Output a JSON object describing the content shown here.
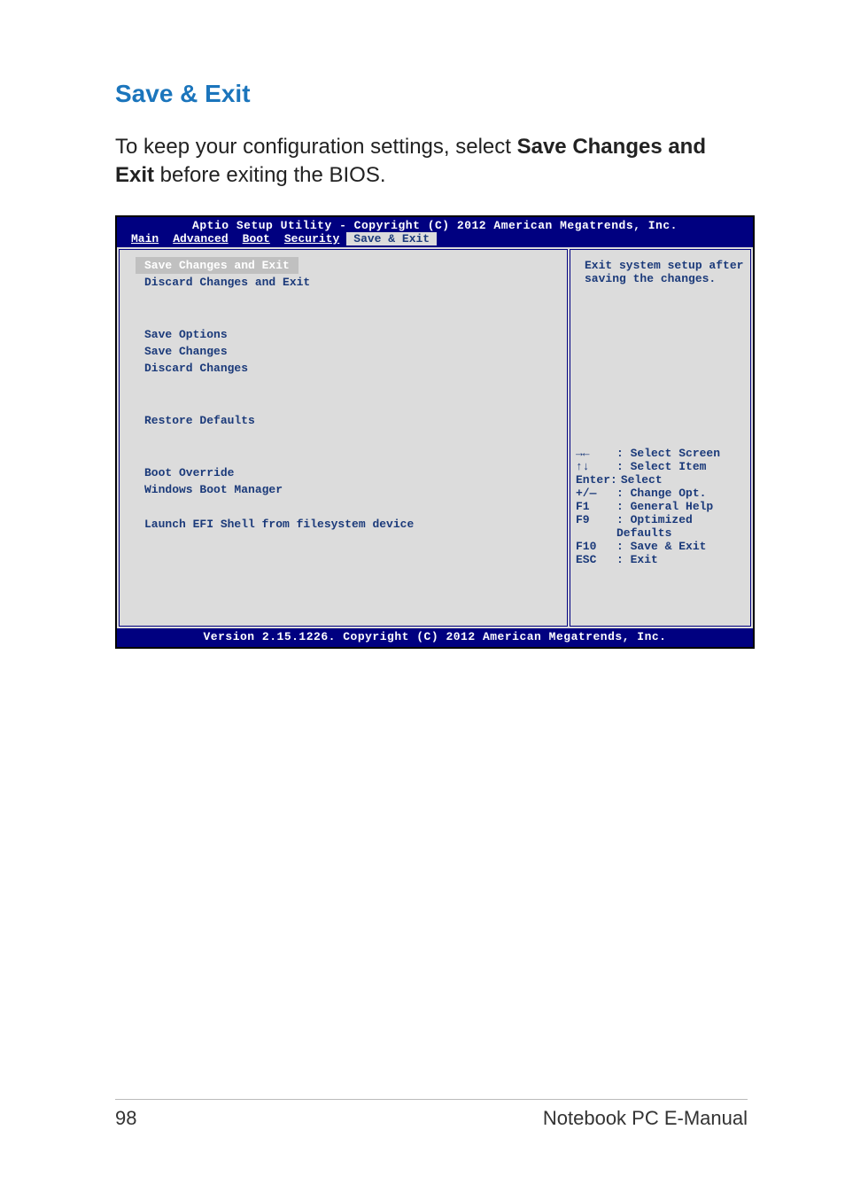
{
  "page": {
    "heading": "Save & Exit",
    "body_prefix": "To keep your configuration settings, select ",
    "body_bold": "Save Changes and Exit",
    "body_suffix": " before exiting the BIOS."
  },
  "bios": {
    "title": "Aptio Setup Utility - Copyright (C) 2012 American Megatrends, Inc.",
    "tabs": {
      "main": "Main",
      "advanced": "Advanced",
      "boot": "Boot",
      "security": "Security",
      "save_exit": "Save & Exit"
    },
    "left": {
      "save_changes_exit": "Save Changes and Exit",
      "discard_changes_exit": "Discard Changes and Exit",
      "save_options_hdr": "Save Options",
      "save_changes": "Save Changes",
      "discard_changes": "Discard Changes",
      "restore_defaults": "Restore Defaults",
      "boot_override_hdr": "Boot Override",
      "windows_boot_manager": "Windows Boot Manager",
      "launch_efi": "Launch EFI Shell from filesystem device"
    },
    "right": {
      "help_text": "Exit system setup after saving the changes.",
      "keys": {
        "lr": {
          "k": "→←",
          "v": ": Select Screen"
        },
        "ud": {
          "k": "↑↓",
          "v": ": Select Item"
        },
        "enter": {
          "k": "Enter:",
          "v": "Select"
        },
        "pm": {
          "k": "+/—",
          "v": ": Change Opt."
        },
        "f1": {
          "k": "F1",
          "v": ": General Help"
        },
        "f9": {
          "k": "F9",
          "v": ": Optimized Defaults"
        },
        "f10": {
          "k": "F10",
          "v": ": Save & Exit"
        },
        "esc": {
          "k": "ESC",
          "v": ": Exit"
        }
      }
    },
    "footer": "Version 2.15.1226. Copyright (C) 2012 American Megatrends, Inc."
  },
  "footer": {
    "page_num": "98",
    "doc_title": "Notebook PC E-Manual"
  }
}
